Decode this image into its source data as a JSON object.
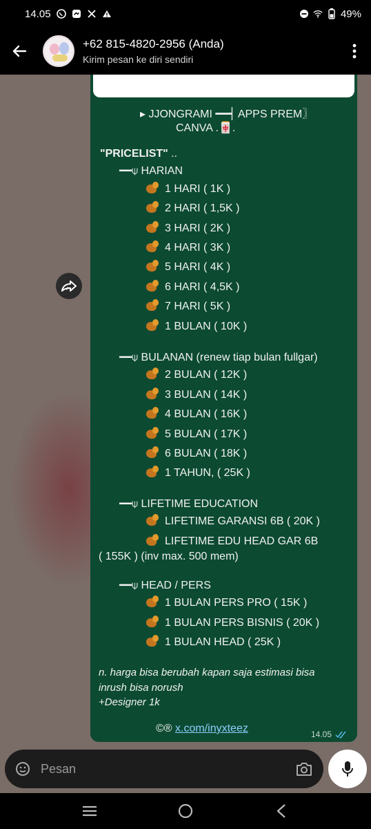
{
  "status_bar": {
    "time": "14.05",
    "battery": "49%"
  },
  "header": {
    "contact_name": "+62 815-4820-2956 (Anda)",
    "contact_subtitle": "Kirim pesan ke diri sendiri"
  },
  "message": {
    "header_line1": "▸ JJONGRAMI ━━┥ APPS PREM〗",
    "header_line2": "CANVA .🀄.",
    "pricelist_title": "\"PRICELIST\"",
    "pricelist_suffix": "..",
    "section_marker": "━━⍦",
    "sections": [
      {
        "title": "HARIAN",
        "items": [
          "1 HARI ( 1K )",
          "2 HARI ( 1,5K )",
          "3 HARI ( 2K )",
          "4 HARI ( 3K )",
          "5 HARI ( 4K )",
          "6 HARI ( 4,5K )",
          "7 HARI ( 5K )",
          "1 BULAN  ( 10K )"
        ]
      },
      {
        "title": "BULANAN (renew tiap bulan fullgar)",
        "items": [
          "2 BULAN  ( 12K )",
          "3 BULAN  ( 14K )",
          "4 BULAN  ( 16K )",
          "5 BULAN  ( 17K )",
          "6 BULAN  ( 18K )",
          "1 TAHUN, ( 25K )"
        ]
      },
      {
        "title": "LIFETIME EDUCATION",
        "items": [
          "LIFETIME GARANSI 6B  ( 20K )",
          "LIFETIME EDU HEAD GAR 6B"
        ],
        "item_continuation": "( 155K ) (inv max. 500 mem)"
      },
      {
        "title": "HEAD / PERS",
        "items": [
          "1 BULAN PERS PRO ( 15K )",
          "1 BULAN PERS BISNIS  ( 20K )",
          "1 BULAN HEAD  ( 25K )"
        ]
      }
    ],
    "note_line1": "n. harga bisa berubah kapan saja estimasi bisa",
    "note_line2": "inrush bisa norush",
    "note_line3": "+Designer 1k",
    "footer_prefix": "©®",
    "footer_link": "x.com/inyxteez",
    "timestamp": "14.05"
  },
  "input": {
    "placeholder": "Pesan"
  },
  "icons": [
    "whatsapp-icon",
    "messenger-icon",
    "x-icon",
    "alert-icon",
    "dnd-icon",
    "wifi-icon",
    "battery-icon",
    "back-arrow-icon",
    "more-vert-icon",
    "forward-icon",
    "sticker-icon",
    "camera-icon",
    "mic-icon",
    "menu-icon",
    "home-icon",
    "back-icon",
    "double-check-icon"
  ],
  "colors": {
    "bubble": "#0c4a32",
    "chat_bg": "#7a6c67",
    "link": "#8fd0ff",
    "check": "#53bdeb"
  }
}
